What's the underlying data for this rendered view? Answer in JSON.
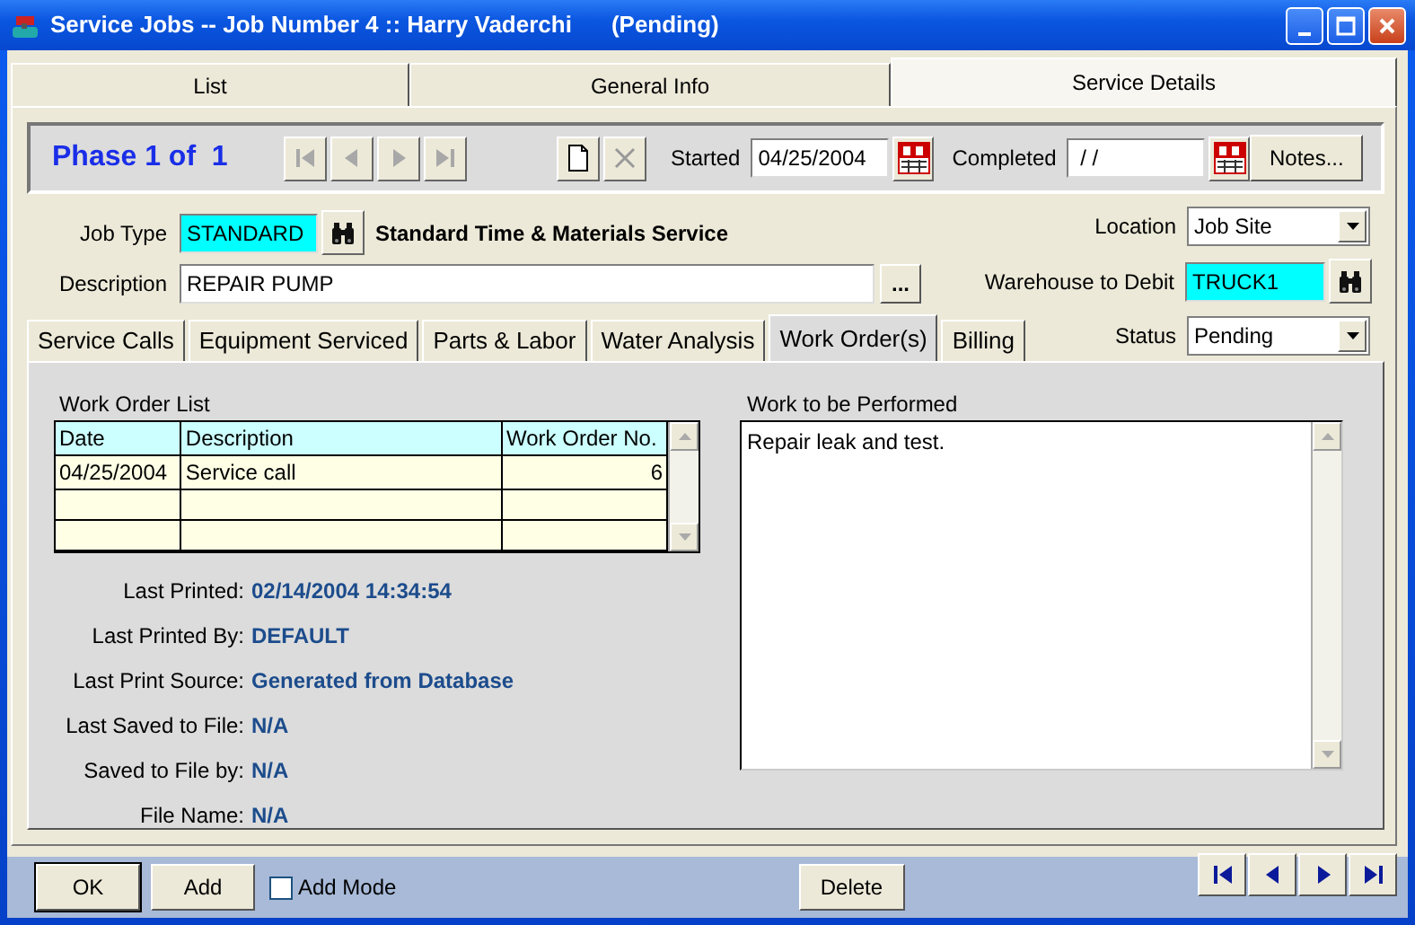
{
  "window": {
    "title": "Service Jobs -- Job Number 4 :: Harry Vaderchi",
    "status": "(Pending)"
  },
  "top_tabs": [
    {
      "label": "List",
      "selected": false
    },
    {
      "label": "General Info",
      "selected": false
    },
    {
      "label": "Service Details",
      "selected": true
    }
  ],
  "phase": {
    "label": "Phase 1 of  1",
    "nav_disabled": true,
    "started_label": "Started",
    "started": "04/25/2004",
    "completed_label": "Completed",
    "completed": " / /",
    "notes_button": "Notes..."
  },
  "job_type": {
    "label": "Job Type",
    "value": "STANDARD",
    "description": "Standard Time & Materials Service"
  },
  "description": {
    "label": "Description",
    "value": "REPAIR PUMP",
    "more_button": "..."
  },
  "location": {
    "label": "Location",
    "value": "Job Site"
  },
  "warehouse": {
    "label": "Warehouse to Debit",
    "value": "TRUCK1"
  },
  "status": {
    "label": "Status",
    "value": "Pending"
  },
  "sub_tabs": [
    {
      "label": "Service Calls",
      "selected": false
    },
    {
      "label": "Equipment Serviced",
      "selected": false
    },
    {
      "label": "Parts & Labor",
      "selected": false
    },
    {
      "label": "Water Analysis",
      "selected": false
    },
    {
      "label": "Work Order(s)",
      "selected": true
    },
    {
      "label": "Billing",
      "selected": false
    }
  ],
  "work_order_list": {
    "title": "Work Order List",
    "columns": [
      "Date",
      "Description",
      "Work Order No."
    ],
    "rows": [
      [
        "04/25/2004",
        "Service call",
        "6"
      ]
    ]
  },
  "info": [
    {
      "label": "Last Printed:",
      "value": "02/14/2004 14:34:54"
    },
    {
      "label": "Last Printed By:",
      "value": "DEFAULT"
    },
    {
      "label": "Last Print Source:",
      "value": "Generated from Database"
    },
    {
      "label": "Last Saved to File:",
      "value": "N/A"
    },
    {
      "label": "Saved to File by:",
      "value": "N/A"
    },
    {
      "label": "File Name:",
      "value": "N/A"
    }
  ],
  "work_to_be_performed": {
    "label": "Work to be Performed",
    "value": "Repair leak and test."
  },
  "bottom": {
    "ok": "OK",
    "add": "Add",
    "add_mode": {
      "label": "Add Mode",
      "checked": false
    },
    "delete": "Delete"
  }
}
